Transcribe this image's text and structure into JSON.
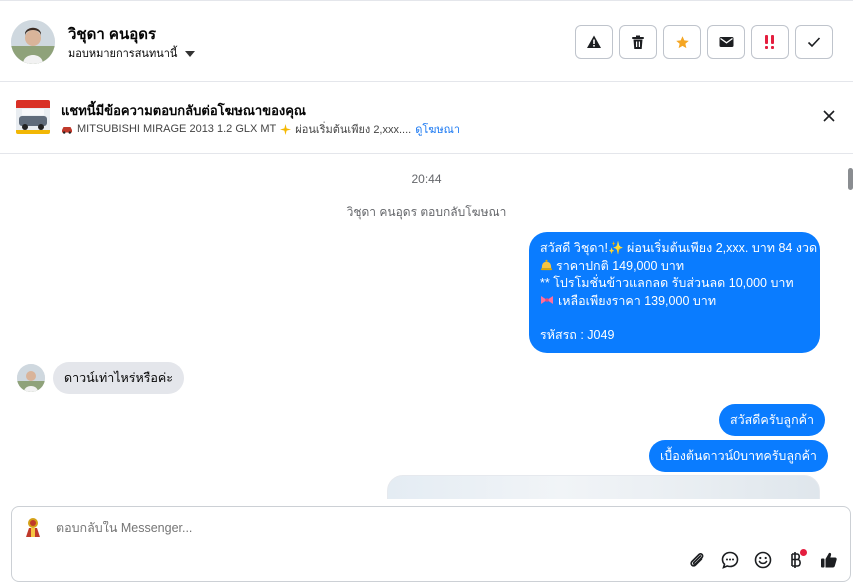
{
  "header": {
    "contact_name": "วิชุดา คนอุดร",
    "assign_label": "มอบหมายการสนทนานี้",
    "actions": [
      {
        "name": "report-spam-button",
        "icon": "warning-icon"
      },
      {
        "name": "delete-button",
        "icon": "trash-icon"
      },
      {
        "name": "star-button",
        "icon": "star-icon"
      },
      {
        "name": "mark-unread-button",
        "icon": "envelope-icon"
      },
      {
        "name": "follow-up-button",
        "icon": "exclamation-icon"
      },
      {
        "name": "mark-done-button",
        "icon": "check-icon"
      }
    ]
  },
  "ad_banner": {
    "title": "แชทนี้มีข้อความตอบกลับต่อโฆษณาของคุณ",
    "car_text": "MITSUBISHI MIRAGE 2013 1.2 GLX MT",
    "promo_text": "ผ่อนเริ่มต้นเพียง 2,xxx....",
    "link_text": "ดูโฆษณา"
  },
  "chat": {
    "time": "20:44",
    "system_message": "วิชุดา คนอุดร ตอบกลับโฆษณา",
    "outgoing_main": {
      "line1": "สวัสดี วิชุดา!✨  ผ่อนเริ่มต้นเพียง 2,xxx. บาท 84 งวด",
      "line2": "ราคาปกติ 149,000 บาท",
      "line3": "** โปรโมชั่นข้าวแลกลด รับส่วนลด 10,000 บาท",
      "line4": "เหลือเพียงราคา 139,000 บาท",
      "line5": "รหัสรถ : J049"
    },
    "incoming": "ดาวน์เท่าไหร่หรือค่ะ",
    "outgoing_2": "สวัสดีครับลูกค้า",
    "outgoing_3": "เบื้องต้นดาวน์0บาทครับลูกค้า"
  },
  "composer": {
    "placeholder": "ตอบกลับใน Messenger..."
  },
  "colors": {
    "accent": "#0a7cff",
    "star": "#f5a623",
    "follow_up": "#e41e3f",
    "link": "#1877f2"
  }
}
